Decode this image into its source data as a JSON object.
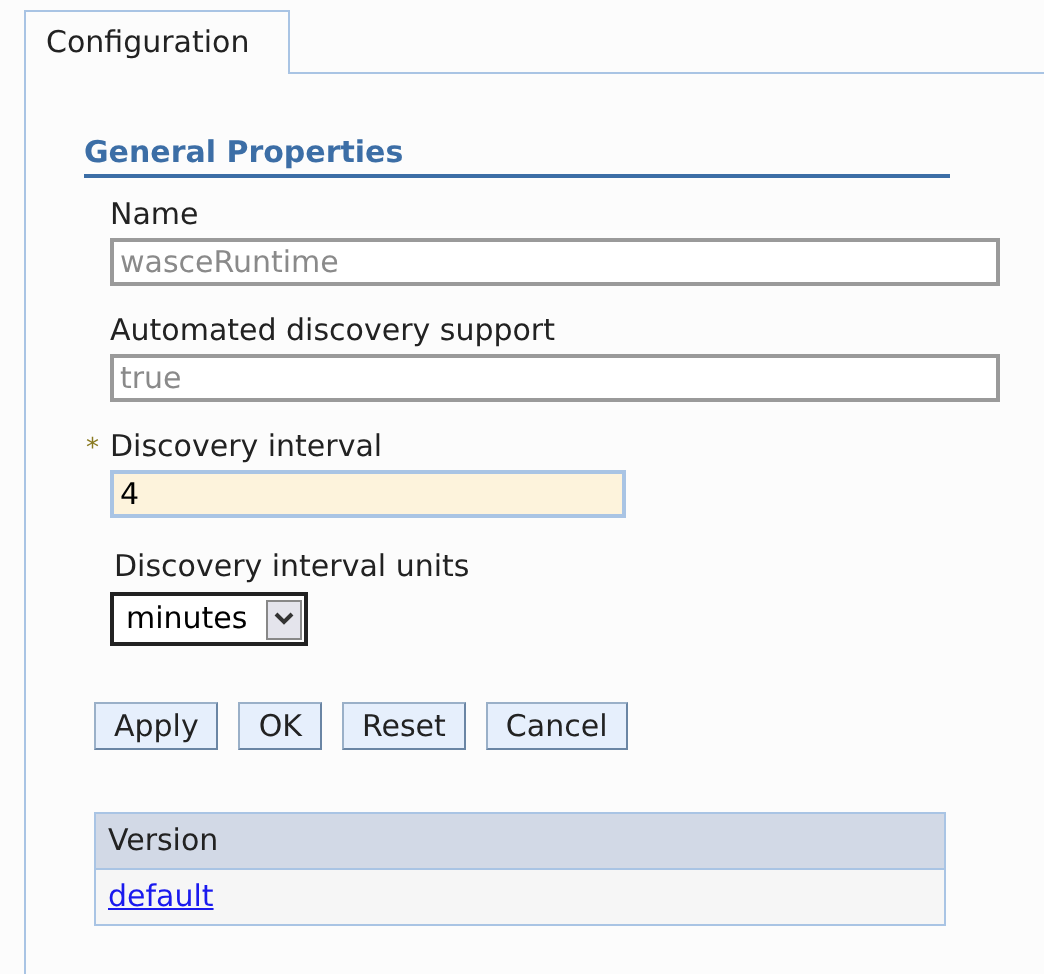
{
  "tabs": [
    {
      "label": "Configuration",
      "selected": true
    }
  ],
  "section": {
    "title": "General Properties"
  },
  "fields": [
    {
      "kind": "text",
      "label": "Name",
      "value": "wasceRuntime",
      "disabled": true
    },
    {
      "kind": "text",
      "label": "Automated discovery support",
      "value": "true",
      "disabled": true
    },
    {
      "kind": "text",
      "label": "Discovery interval",
      "value": "4",
      "disabled": false,
      "required_mark": "*"
    },
    {
      "kind": "select",
      "label": "Discovery interval units",
      "value": "minutes"
    }
  ],
  "buttons": [
    "Apply",
    "OK",
    "Reset",
    "Cancel"
  ],
  "table": {
    "columns": [
      "Version"
    ],
    "rows": [
      [
        "default"
      ]
    ]
  }
}
